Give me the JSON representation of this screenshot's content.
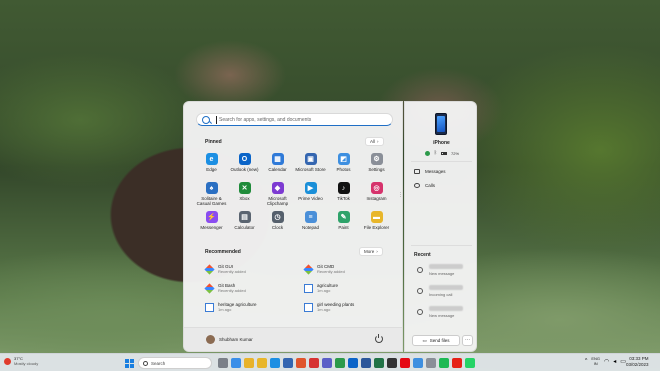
{
  "start_menu": {
    "search_placeholder": "Search for apps, settings, and documents",
    "pinned_title": "Pinned",
    "all_label": "All",
    "pinned_apps": [
      {
        "label": "Edge",
        "icon": "edge-icon",
        "color": "#1c8fe3",
        "glyph": "e"
      },
      {
        "label": "Outlook (new)",
        "icon": "outlook-icon",
        "color": "#0a64c8",
        "glyph": "O"
      },
      {
        "label": "Calendar",
        "icon": "calendar-icon",
        "color": "#2f7ad8",
        "glyph": "▦"
      },
      {
        "label": "Microsoft Store",
        "icon": "store-icon",
        "color": "#3466b0",
        "glyph": "▣"
      },
      {
        "label": "Photos",
        "icon": "photos-icon",
        "color": "#3d8fe0",
        "glyph": "◩"
      },
      {
        "label": "Settings",
        "icon": "settings-icon",
        "color": "#8a8f98",
        "glyph": "⚙"
      },
      {
        "label": "Solitaire & Casual Games",
        "icon": "solitaire-icon",
        "color": "#2b6fc2",
        "glyph": "♠"
      },
      {
        "label": "Xbox",
        "icon": "xbox-icon",
        "color": "#1f8b3a",
        "glyph": "✕"
      },
      {
        "label": "Microsoft Clipchamp",
        "icon": "clipchamp-icon",
        "color": "#7d3bd2",
        "glyph": "◆"
      },
      {
        "label": "Prime Video",
        "icon": "prime-video-icon",
        "color": "#1a8fd8",
        "glyph": "▶"
      },
      {
        "label": "TikTok",
        "icon": "tiktok-icon",
        "color": "#111111",
        "glyph": "♪"
      },
      {
        "label": "Instagram",
        "icon": "instagram-icon",
        "color": "#d6336c",
        "glyph": "◎"
      },
      {
        "label": "Messenger",
        "icon": "messenger-icon",
        "color": "#8a4cf0",
        "glyph": "⚡"
      },
      {
        "label": "Calculator",
        "icon": "calculator-icon",
        "color": "#5a6470",
        "glyph": "▤"
      },
      {
        "label": "Clock",
        "icon": "clock-icon",
        "color": "#55606c",
        "glyph": "◷"
      },
      {
        "label": "Notepad",
        "icon": "notepad-icon",
        "color": "#4a8fd8",
        "glyph": "≡"
      },
      {
        "label": "Paint",
        "icon": "paint-icon",
        "color": "#2ea36a",
        "glyph": "✎"
      },
      {
        "label": "File Explorer",
        "icon": "file-explorer-icon",
        "color": "#e8b62a",
        "glyph": "▬"
      }
    ],
    "recommended_title": "Recommended",
    "more_label": "More",
    "recommended": [
      {
        "name": "Git GUI",
        "sub": "Recently added",
        "icon": "git-icon"
      },
      {
        "name": "Git CMD",
        "sub": "Recently added",
        "icon": "git-icon"
      },
      {
        "name": "Git Bash",
        "sub": "Recently added",
        "icon": "git-icon"
      },
      {
        "name": "agriculture",
        "sub": "1m ago",
        "icon": "file-icon"
      },
      {
        "name": "heritage agriculture",
        "sub": "1m ago",
        "icon": "file-icon"
      },
      {
        "name": "girl weeding plants",
        "sub": "1m ago",
        "icon": "file-icon"
      }
    ],
    "user_name": "Shubham Kumar"
  },
  "phone_link": {
    "device_name": "iPhone",
    "battery": "72%",
    "messages_label": "Messages",
    "calls_label": "Calls",
    "recent_title": "Recent",
    "recent": [
      {
        "text": "New message",
        "icon": "message-icon"
      },
      {
        "text": "Incoming call",
        "icon": "phone-icon"
      },
      {
        "text": "New message",
        "icon": "message-icon"
      }
    ],
    "send_files_label": "Send files",
    "more_label": "···"
  },
  "taskbar": {
    "weather_temp": "37°C",
    "weather_desc": "Mostly cloudy",
    "search_label": "Search",
    "lang_line1": "ENG",
    "lang_line2": "IN",
    "time": "03:33 PM",
    "date": "03/02/2023",
    "icons": [
      {
        "name": "task-view-icon",
        "color": "#7a7f88"
      },
      {
        "name": "widget-icon",
        "color": "#3a8ee8"
      },
      {
        "name": "chrome-icon",
        "color": "#e8b22a"
      },
      {
        "name": "file-explorer-icon",
        "color": "#e8b62a"
      },
      {
        "name": "edge-icon",
        "color": "#1c8fe3"
      },
      {
        "name": "store-icon",
        "color": "#3466b0"
      },
      {
        "name": "brave-icon",
        "color": "#e0552c"
      },
      {
        "name": "opera-icon",
        "color": "#d63232"
      },
      {
        "name": "teams-icon",
        "color": "#5b5fc7"
      },
      {
        "name": "chrome-icon",
        "color": "#2c9a4a"
      },
      {
        "name": "outlook-icon",
        "color": "#0a64c8"
      },
      {
        "name": "word-icon",
        "color": "#2b579a"
      },
      {
        "name": "excel-icon",
        "color": "#217346"
      },
      {
        "name": "terminal-icon",
        "color": "#333333"
      },
      {
        "name": "netflix-icon",
        "color": "#e50914"
      },
      {
        "name": "photos-icon",
        "color": "#3d8fe0"
      },
      {
        "name": "settings-icon",
        "color": "#8a8f98"
      },
      {
        "name": "spotify-icon",
        "color": "#1db954"
      },
      {
        "name": "youtube-icon",
        "color": "#e62117"
      },
      {
        "name": "whatsapp-icon",
        "color": "#25d366"
      }
    ]
  }
}
